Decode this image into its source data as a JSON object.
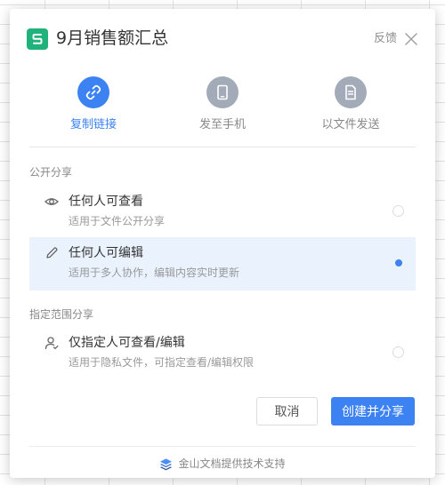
{
  "dialog": {
    "title": "9月销售额汇总",
    "feedback": "反馈",
    "app_logo_letter": "S"
  },
  "share_tabs": [
    {
      "label": "复制链接",
      "icon": "link-icon",
      "active": true
    },
    {
      "label": "发至手机",
      "icon": "phone-icon",
      "active": false
    },
    {
      "label": "以文件发送",
      "icon": "document-icon",
      "active": false
    }
  ],
  "public_share": {
    "section_label": "公开分享",
    "options": [
      {
        "title": "任何人可查看",
        "desc": "适用于文件公开分享",
        "icon": "eye-icon",
        "selected": false
      },
      {
        "title": "任何人可编辑",
        "desc": "适用于多人协作，编辑内容实时更新",
        "icon": "pencil-icon",
        "selected": true
      }
    ]
  },
  "restricted_share": {
    "section_label": "指定范围分享",
    "options": [
      {
        "title": "仅指定人可查看/编辑",
        "desc": "适用于隐私文件，可指定查看/编辑权限",
        "icon": "user-icon",
        "selected": false
      }
    ]
  },
  "buttons": {
    "cancel": "取消",
    "create": "创建并分享"
  },
  "footer": {
    "text": "金山文档提供技术支持",
    "icon": "layers-icon"
  },
  "colors": {
    "accent": "#3d82f2",
    "logo": "#1fb27a",
    "selected_bg": "#eaf2fe"
  }
}
